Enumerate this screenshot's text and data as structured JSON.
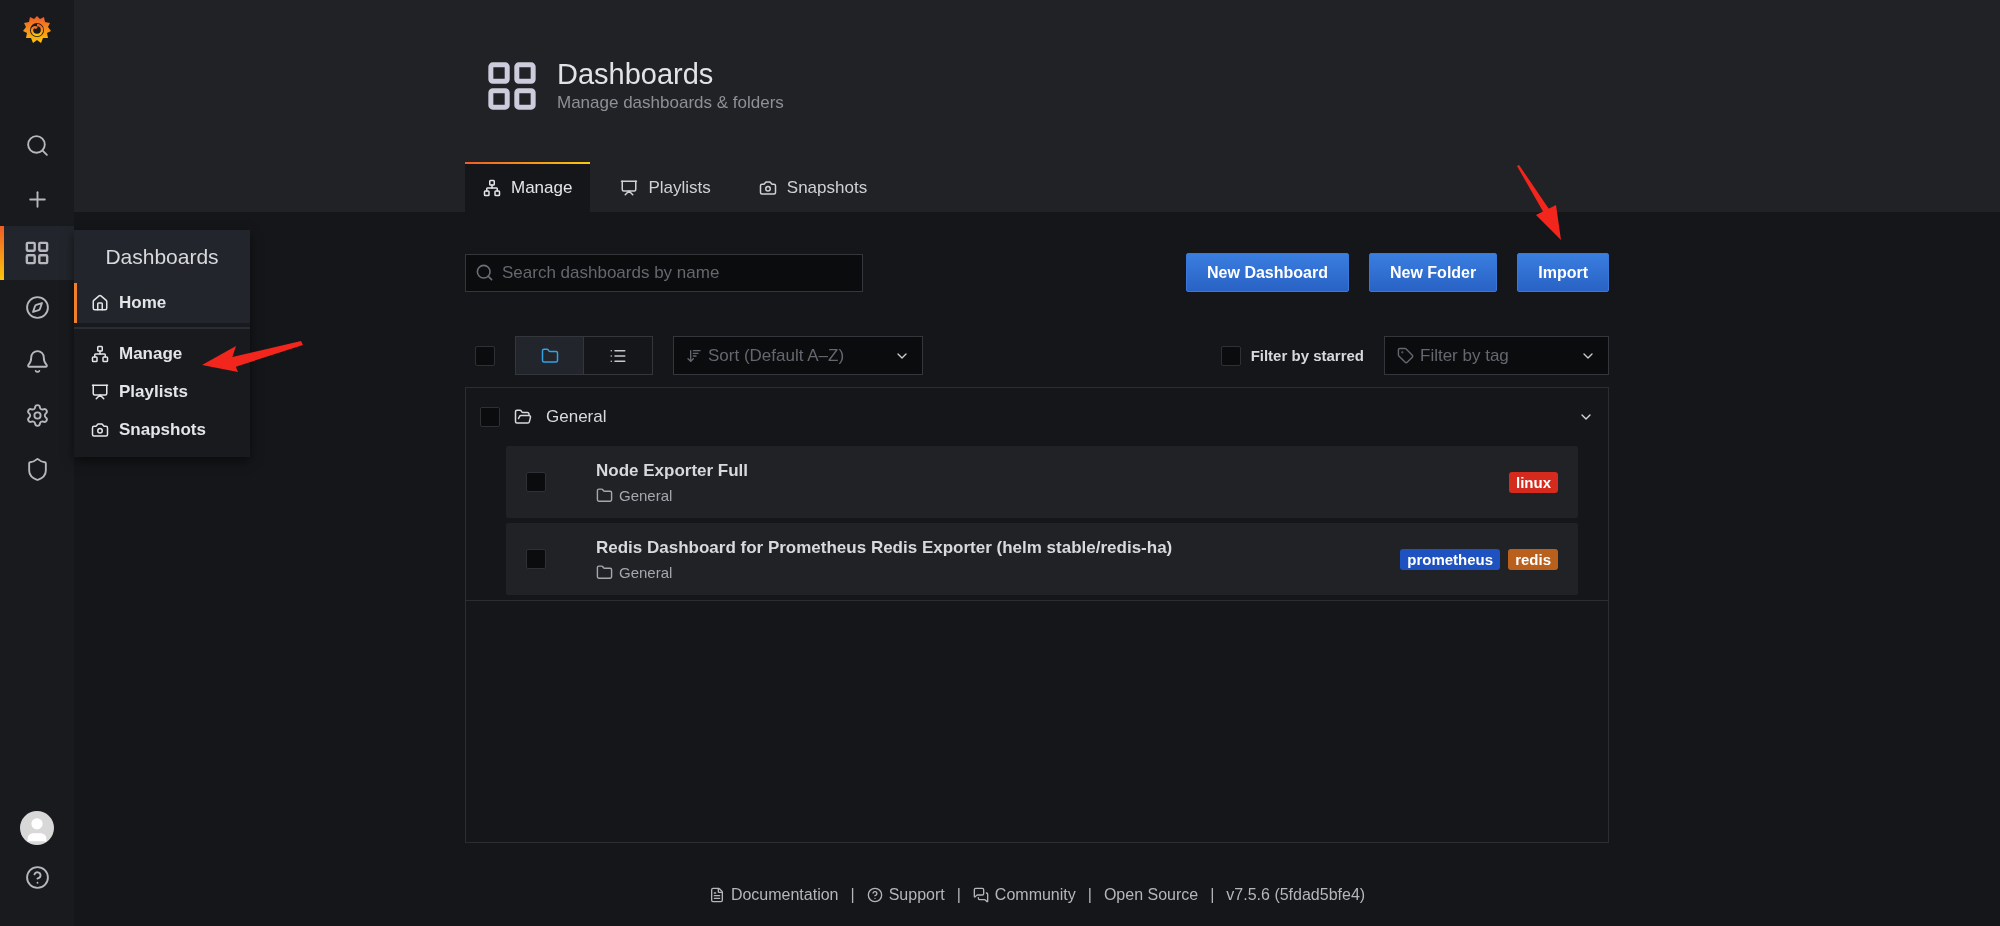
{
  "sidebar": {
    "items": [
      {
        "selected": false
      },
      {
        "selected": false
      },
      {
        "selected": true
      },
      {
        "selected": false
      },
      {
        "selected": false
      },
      {
        "selected": false
      },
      {
        "selected": false
      }
    ]
  },
  "submenu": {
    "title": "Dashboards",
    "items": [
      {
        "label": "Home",
        "selected": true
      },
      {
        "label": "Manage",
        "selected": false
      },
      {
        "label": "Playlists",
        "selected": false
      },
      {
        "label": "Snapshots",
        "selected": false
      }
    ]
  },
  "header": {
    "title": "Dashboards",
    "subtitle": "Manage dashboards & folders"
  },
  "tabs": [
    {
      "label": "Manage",
      "selected": true
    },
    {
      "label": "Playlists",
      "selected": false
    },
    {
      "label": "Snapshots",
      "selected": false
    }
  ],
  "search": {
    "placeholder": "Search dashboards by name"
  },
  "buttons": [
    "New Dashboard",
    "New Folder",
    "Import"
  ],
  "list_controls": {
    "select_all": {
      "checked": false
    },
    "view_toggle": [
      {
        "selected": true
      },
      {
        "selected": false
      }
    ],
    "sort": {
      "placeholder": "Sort (Default A–Z)"
    },
    "starred_filter": {
      "label": "Filter by starred",
      "checked": false
    },
    "tag_filter": {
      "placeholder": "Filter by tag"
    }
  },
  "folders": [
    {
      "name": "General",
      "checked": false,
      "expanded": true,
      "dashboards": [
        {
          "title": "Node Exporter Full",
          "folder": "General",
          "checked": false,
          "tags": [
            {
              "label": "linux",
              "color": "#d52a1e"
            }
          ]
        },
        {
          "title": "Redis Dashboard for Prometheus Redis Exporter (helm stable/redis-ha)",
          "folder": "General",
          "checked": false,
          "tags": [
            {
              "label": "prometheus",
              "color": "#1e52c0"
            },
            {
              "label": "redis",
              "color": "#b8601c"
            }
          ]
        }
      ]
    }
  ],
  "footer": [
    {
      "label": "Documentation"
    },
    {
      "separator": "|",
      "label": "Support"
    },
    {
      "separator": "|",
      "label": "Community"
    },
    {
      "separator": "|",
      "label": "Open Source"
    },
    {
      "separator": "|",
      "label": "v7.5.6 (5fdad5bfe4)"
    }
  ]
}
